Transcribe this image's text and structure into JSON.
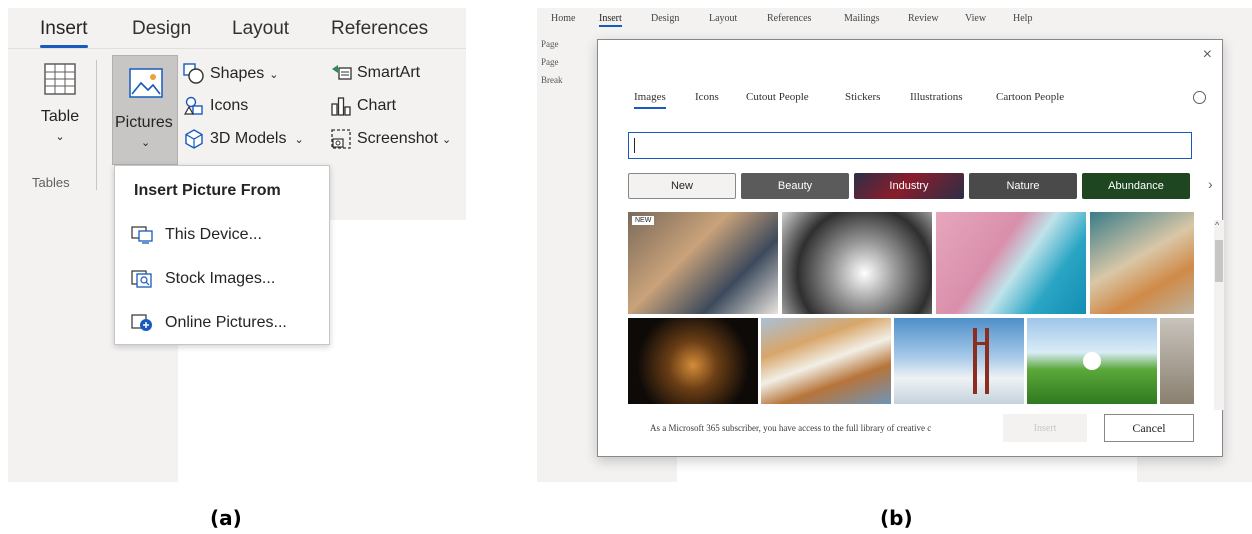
{
  "panel_a": {
    "tabs": [
      "Insert",
      "Design",
      "Layout",
      "References"
    ],
    "active_tab": "Insert",
    "ribbon": {
      "table_label": "Table",
      "pictures_label": "Pictures",
      "shapes_label": "Shapes",
      "icons_label": "Icons",
      "models_label": "3D Models",
      "smartart_label": "SmartArt",
      "chart_label": "Chart",
      "screenshot_label": "Screenshot",
      "group_tables": "Tables"
    },
    "dropdown": {
      "title": "Insert Picture From",
      "items": [
        {
          "label": "This Device...",
          "icon": "device-icon"
        },
        {
          "label": "Stock Images...",
          "icon": "stock-images-icon"
        },
        {
          "label": "Online Pictures...",
          "icon": "online-pictures-icon"
        }
      ]
    },
    "caption": "(a)"
  },
  "panel_b": {
    "tabs": [
      "Home",
      "Insert",
      "Design",
      "Layout",
      "References",
      "Mailings",
      "Review",
      "View",
      "Help"
    ],
    "active_tab": "Insert",
    "side_texts": [
      "Page",
      "Page",
      "Break"
    ],
    "dialog": {
      "tabs": [
        "Images",
        "Icons",
        "Cutout People",
        "Stickers",
        "Illustrations",
        "Cartoon People"
      ],
      "active_tab": "Images",
      "search_value": "",
      "chips": [
        {
          "label": "New",
          "color": "#f3f2f1"
        },
        {
          "label": "Beauty",
          "color": "#5b5b5b"
        },
        {
          "label": "Industry",
          "color": "#2b2f48"
        },
        {
          "label": "Nature",
          "color": "#4a4a4a"
        },
        {
          "label": "Abundance",
          "color": "#1e4620"
        }
      ],
      "new_badge": "NEW",
      "footer_text": "As a Microsoft 365 subscriber, you have access to the full library of creative c",
      "insert_label": "Insert",
      "cancel_label": "Cancel",
      "close_label": "×"
    },
    "caption": "(b)"
  }
}
